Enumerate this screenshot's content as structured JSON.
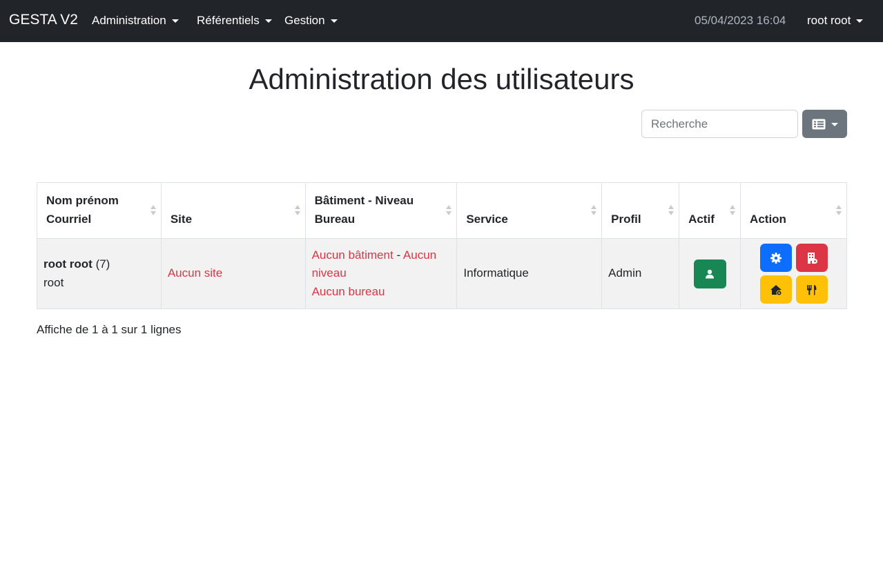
{
  "navbar": {
    "brand": "GESTA V2",
    "menu": [
      {
        "label": "Administration"
      },
      {
        "label": "Référentiels"
      },
      {
        "label": "Gestion"
      }
    ],
    "datetime": "05/04/2023 16:04",
    "user": "root root"
  },
  "page": {
    "title": "Administration des utilisateurs"
  },
  "search": {
    "placeholder": "Recherche"
  },
  "table": {
    "headers": {
      "name_line1": "Nom prénom",
      "name_line2": "Courriel",
      "site": "Site",
      "building_line1": "Bâtiment - Niveau",
      "building_line2": "Bureau",
      "service": "Service",
      "profile": "Profil",
      "active": "Actif",
      "action": "Action"
    },
    "rows": [
      {
        "name": "root root",
        "id": "(7)",
        "email": "root",
        "site": "Aucun site",
        "building": "Aucun bâtiment",
        "separator": "-",
        "level": "Aucun niveau",
        "office": "Aucun bureau",
        "service": "Informatique",
        "profile": "Admin"
      }
    ]
  },
  "pagination_info": "Affiche de 1 à 1 sur 1 lignes",
  "colors": {
    "navbar": "#212529",
    "primary": "#0d6efd",
    "danger": "#dc3545",
    "success": "#198754",
    "warning": "#ffc107",
    "secondary": "#6c757d"
  },
  "icons": {
    "column_toggle": "list-icon",
    "active": "user-icon",
    "settings": "gear-icon",
    "building": "building-icon",
    "home_settings": "house-gear-icon",
    "restaurant": "utensils-icon"
  }
}
